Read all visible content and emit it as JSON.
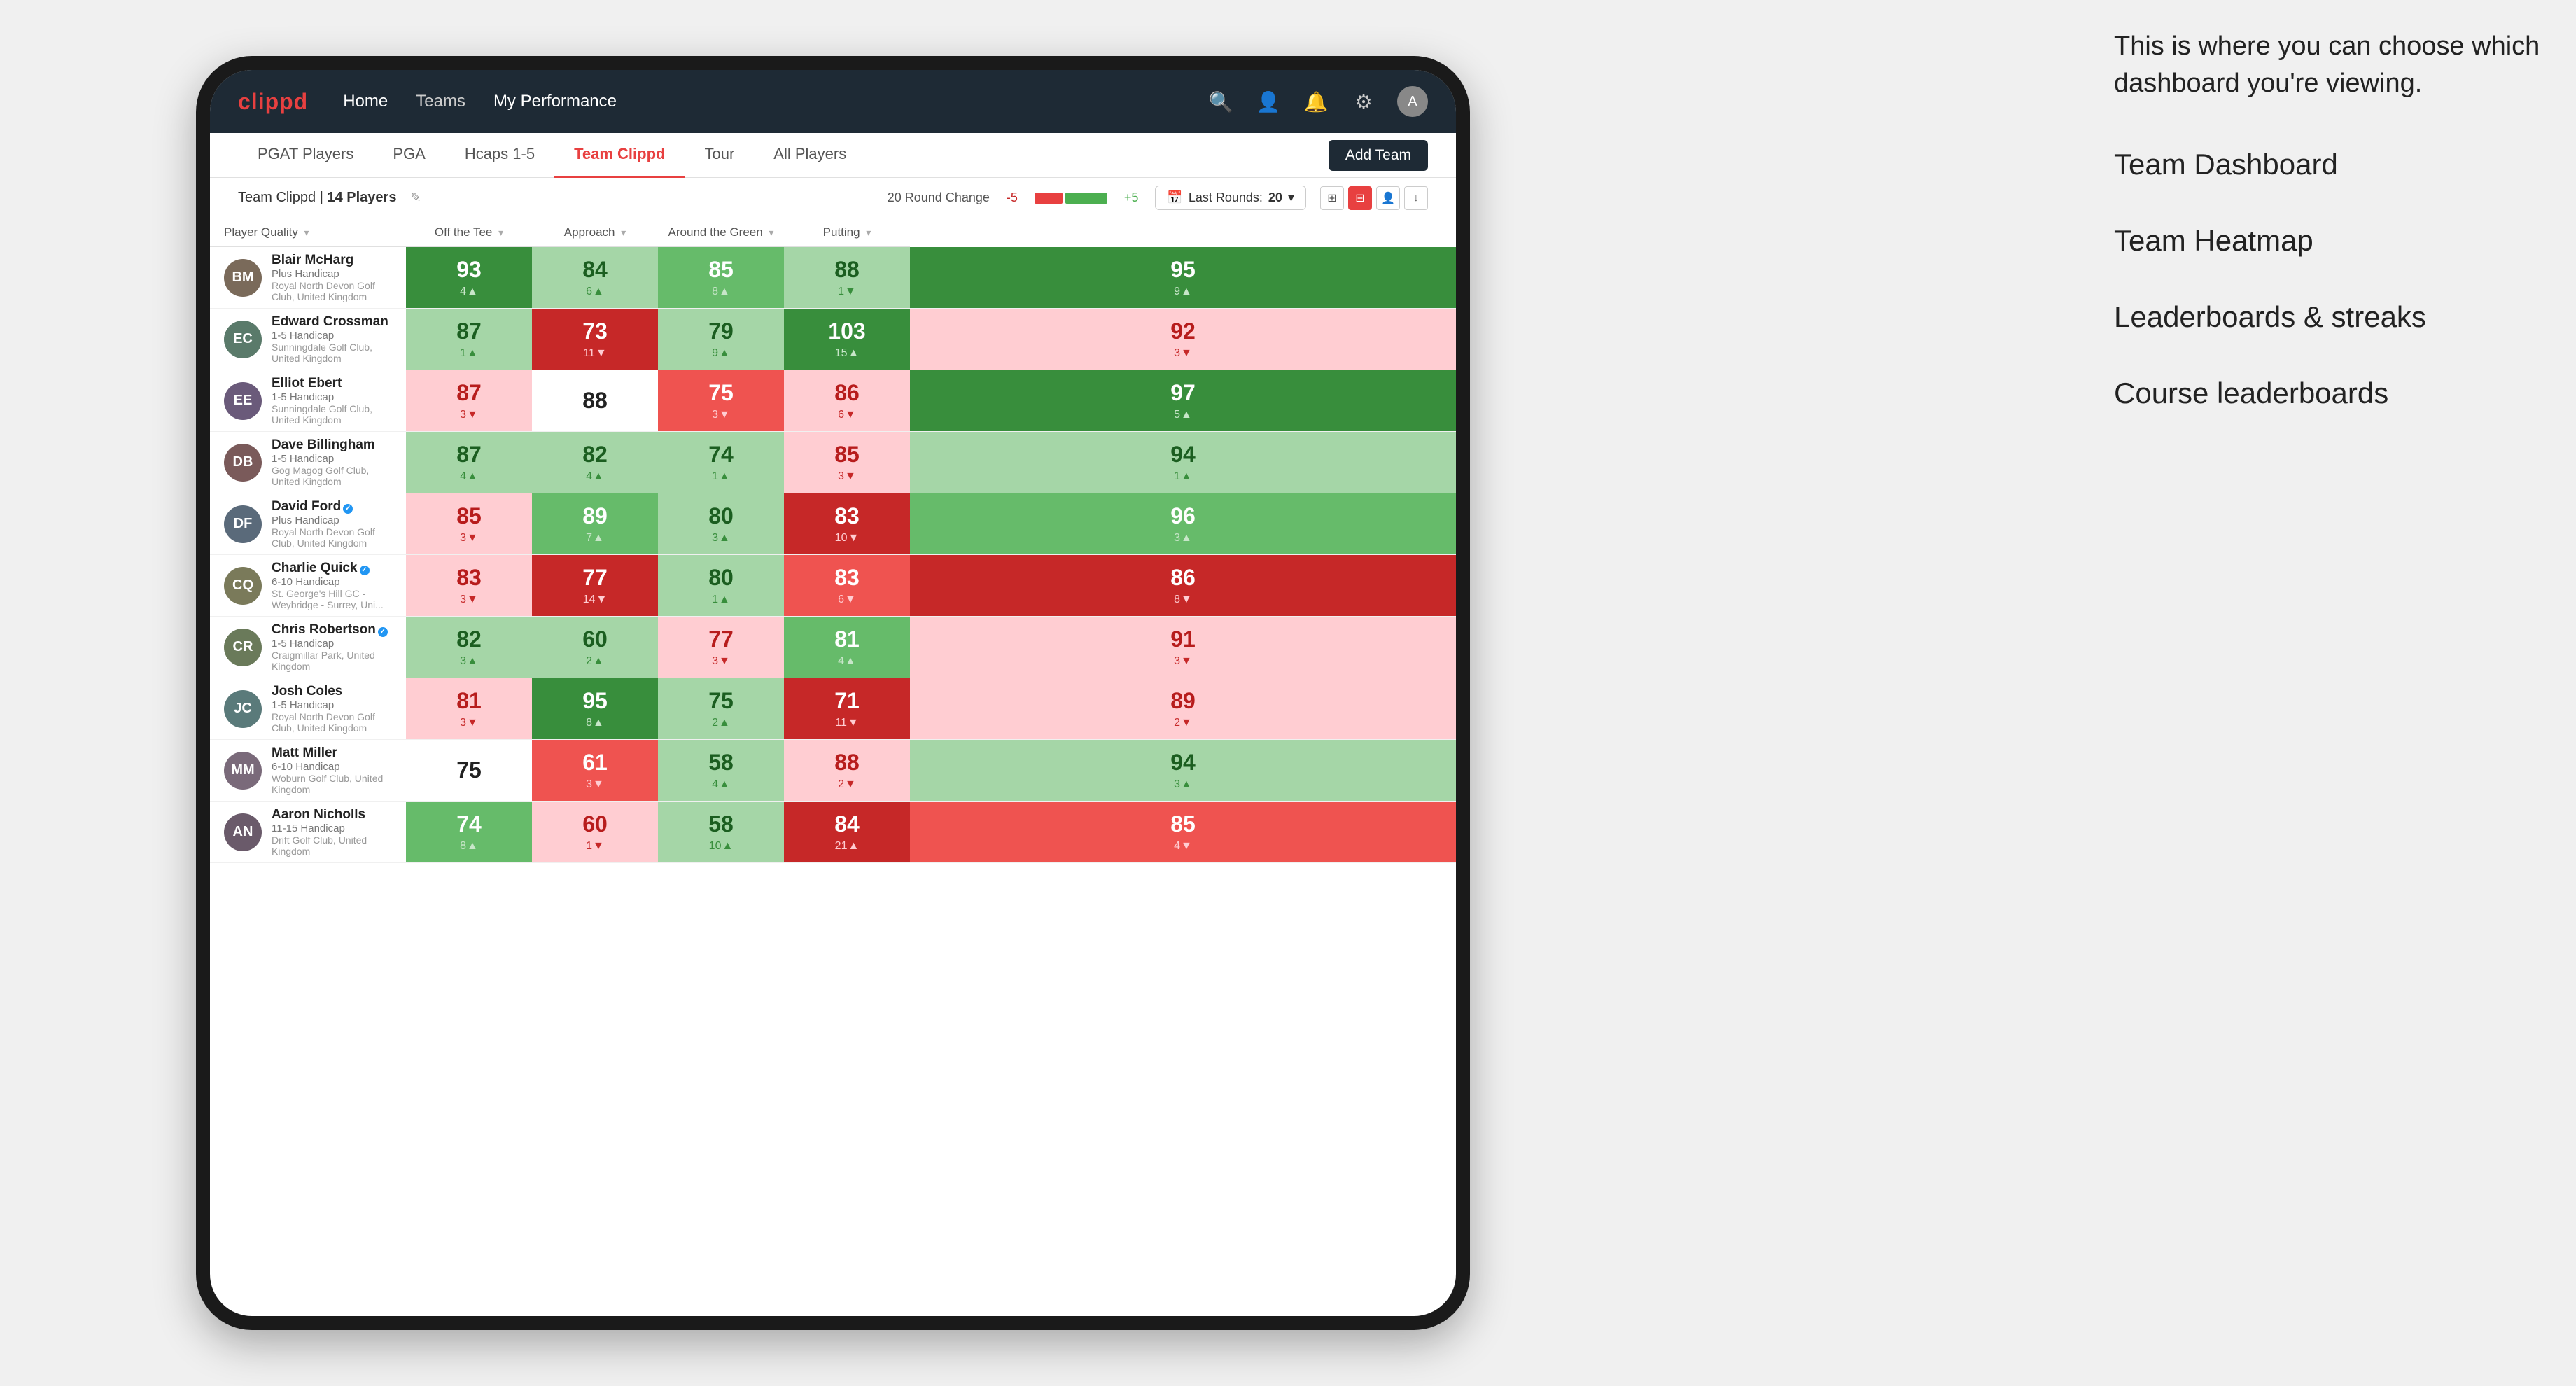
{
  "annotation": {
    "intro_text": "This is where you can choose which dashboard you're viewing.",
    "options": [
      "Team Dashboard",
      "Team Heatmap",
      "Leaderboards & streaks",
      "Course leaderboards"
    ]
  },
  "navbar": {
    "brand": "clippd",
    "links": [
      "Home",
      "Teams",
      "My Performance"
    ],
    "active_link": "My Performance"
  },
  "tabs": {
    "items": [
      "PGAT Players",
      "PGA",
      "Hcaps 1-5",
      "Team Clippd",
      "Tour",
      "All Players"
    ],
    "active": "Team Clippd",
    "add_button": "Add Team"
  },
  "toolbar": {
    "team_name": "Team Clippd",
    "player_count": "14 Players",
    "round_change_label": "20 Round Change",
    "range_neg": "-5",
    "range_pos": "+5",
    "last_rounds_label": "Last Rounds:",
    "last_rounds_count": "20"
  },
  "table": {
    "columns": {
      "player": "Player Quality",
      "off_tee": "Off the Tee",
      "approach": "Approach",
      "around_green": "Around the Green",
      "putting": "Putting"
    },
    "rows": [
      {
        "name": "Blair McHarg",
        "handicap": "Plus Handicap",
        "club": "Royal North Devon Golf Club, United Kingdom",
        "initials": "BM",
        "color": "#7a6a5a",
        "player_quality": {
          "score": 93,
          "change": 4,
          "dir": "up",
          "bg": "bg-green-dark"
        },
        "off_tee": {
          "score": 84,
          "change": 6,
          "dir": "up",
          "bg": "bg-green-light"
        },
        "approach": {
          "score": 85,
          "change": 8,
          "dir": "up",
          "bg": "bg-green-mid"
        },
        "around_green": {
          "score": 88,
          "change": 1,
          "dir": "down",
          "bg": "bg-green-light"
        },
        "putting": {
          "score": 95,
          "change": 9,
          "dir": "up",
          "bg": "bg-green-dark"
        }
      },
      {
        "name": "Edward Crossman",
        "handicap": "1-5 Handicap",
        "club": "Sunningdale Golf Club, United Kingdom",
        "initials": "EC",
        "color": "#5a7a6a",
        "player_quality": {
          "score": 87,
          "change": 1,
          "dir": "up",
          "bg": "bg-green-light"
        },
        "off_tee": {
          "score": 73,
          "change": 11,
          "dir": "down",
          "bg": "bg-red-dark"
        },
        "approach": {
          "score": 79,
          "change": 9,
          "dir": "up",
          "bg": "bg-green-light"
        },
        "around_green": {
          "score": 103,
          "change": 15,
          "dir": "up",
          "bg": "bg-green-dark"
        },
        "putting": {
          "score": 92,
          "change": 3,
          "dir": "down",
          "bg": "bg-red-light"
        }
      },
      {
        "name": "Elliot Ebert",
        "handicap": "1-5 Handicap",
        "club": "Sunningdale Golf Club, United Kingdom",
        "initials": "EE",
        "color": "#6a5a7a",
        "player_quality": {
          "score": 87,
          "change": 3,
          "dir": "down",
          "bg": "bg-red-light"
        },
        "off_tee": {
          "score": 88,
          "change": 0,
          "dir": "none",
          "bg": "bg-white"
        },
        "approach": {
          "score": 75,
          "change": 3,
          "dir": "down",
          "bg": "bg-red-mid"
        },
        "around_green": {
          "score": 86,
          "change": 6,
          "dir": "down",
          "bg": "bg-red-light"
        },
        "putting": {
          "score": 97,
          "change": 5,
          "dir": "up",
          "bg": "bg-green-dark"
        }
      },
      {
        "name": "Dave Billingham",
        "handicap": "1-5 Handicap",
        "club": "Gog Magog Golf Club, United Kingdom",
        "initials": "DB",
        "color": "#7a5a5a",
        "player_quality": {
          "score": 87,
          "change": 4,
          "dir": "up",
          "bg": "bg-green-light"
        },
        "off_tee": {
          "score": 82,
          "change": 4,
          "dir": "up",
          "bg": "bg-green-light"
        },
        "approach": {
          "score": 74,
          "change": 1,
          "dir": "up",
          "bg": "bg-green-light"
        },
        "around_green": {
          "score": 85,
          "change": 3,
          "dir": "down",
          "bg": "bg-red-light"
        },
        "putting": {
          "score": 94,
          "change": 1,
          "dir": "up",
          "bg": "bg-green-light"
        }
      },
      {
        "name": "David Ford",
        "handicap": "Plus Handicap",
        "club": "Royal North Devon Golf Club, United Kingdom",
        "initials": "DF",
        "color": "#5a6a7a",
        "verified": true,
        "player_quality": {
          "score": 85,
          "change": 3,
          "dir": "down",
          "bg": "bg-red-light"
        },
        "off_tee": {
          "score": 89,
          "change": 7,
          "dir": "up",
          "bg": "bg-green-mid"
        },
        "approach": {
          "score": 80,
          "change": 3,
          "dir": "up",
          "bg": "bg-green-light"
        },
        "around_green": {
          "score": 83,
          "change": 10,
          "dir": "down",
          "bg": "bg-red-dark"
        },
        "putting": {
          "score": 96,
          "change": 3,
          "dir": "up",
          "bg": "bg-green-mid"
        }
      },
      {
        "name": "Charlie Quick",
        "handicap": "6-10 Handicap",
        "club": "St. George's Hill GC - Weybridge - Surrey, Uni...",
        "initials": "CQ",
        "color": "#7a7a5a",
        "verified": true,
        "player_quality": {
          "score": 83,
          "change": 3,
          "dir": "down",
          "bg": "bg-red-light"
        },
        "off_tee": {
          "score": 77,
          "change": 14,
          "dir": "down",
          "bg": "bg-red-dark"
        },
        "approach": {
          "score": 80,
          "change": 1,
          "dir": "up",
          "bg": "bg-green-light"
        },
        "around_green": {
          "score": 83,
          "change": 6,
          "dir": "down",
          "bg": "bg-red-mid"
        },
        "putting": {
          "score": 86,
          "change": 8,
          "dir": "down",
          "bg": "bg-red-dark"
        }
      },
      {
        "name": "Chris Robertson",
        "handicap": "1-5 Handicap",
        "club": "Craigmillar Park, United Kingdom",
        "initials": "CR",
        "color": "#6a7a5a",
        "verified": true,
        "player_quality": {
          "score": 82,
          "change": 3,
          "dir": "up",
          "bg": "bg-green-light"
        },
        "off_tee": {
          "score": 60,
          "change": 2,
          "dir": "up",
          "bg": "bg-green-light"
        },
        "approach": {
          "score": 77,
          "change": 3,
          "dir": "down",
          "bg": "bg-red-light"
        },
        "around_green": {
          "score": 81,
          "change": 4,
          "dir": "up",
          "bg": "bg-green-mid"
        },
        "putting": {
          "score": 91,
          "change": 3,
          "dir": "down",
          "bg": "bg-red-light"
        }
      },
      {
        "name": "Josh Coles",
        "handicap": "1-5 Handicap",
        "club": "Royal North Devon Golf Club, United Kingdom",
        "initials": "JC",
        "color": "#5a7a7a",
        "player_quality": {
          "score": 81,
          "change": 3,
          "dir": "down",
          "bg": "bg-red-light"
        },
        "off_tee": {
          "score": 95,
          "change": 8,
          "dir": "up",
          "bg": "bg-green-dark"
        },
        "approach": {
          "score": 75,
          "change": 2,
          "dir": "up",
          "bg": "bg-green-light"
        },
        "around_green": {
          "score": 71,
          "change": 11,
          "dir": "down",
          "bg": "bg-red-dark"
        },
        "putting": {
          "score": 89,
          "change": 2,
          "dir": "down",
          "bg": "bg-red-light"
        }
      },
      {
        "name": "Matt Miller",
        "handicap": "6-10 Handicap",
        "club": "Woburn Golf Club, United Kingdom",
        "initials": "MM",
        "color": "#7a6a7a",
        "player_quality": {
          "score": 75,
          "change": 0,
          "dir": "none",
          "bg": "bg-white"
        },
        "off_tee": {
          "score": 61,
          "change": 3,
          "dir": "down",
          "bg": "bg-red-mid"
        },
        "approach": {
          "score": 58,
          "change": 4,
          "dir": "up",
          "bg": "bg-green-light"
        },
        "around_green": {
          "score": 88,
          "change": 2,
          "dir": "down",
          "bg": "bg-red-light"
        },
        "putting": {
          "score": 94,
          "change": 3,
          "dir": "up",
          "bg": "bg-green-light"
        }
      },
      {
        "name": "Aaron Nicholls",
        "handicap": "11-15 Handicap",
        "club": "Drift Golf Club, United Kingdom",
        "initials": "AN",
        "color": "#6a5a6a",
        "player_quality": {
          "score": 74,
          "change": 8,
          "dir": "up",
          "bg": "bg-green-mid"
        },
        "off_tee": {
          "score": 60,
          "change": 1,
          "dir": "down",
          "bg": "bg-red-light"
        },
        "approach": {
          "score": 58,
          "change": 10,
          "dir": "up",
          "bg": "bg-green-light"
        },
        "around_green": {
          "score": 84,
          "change": 21,
          "dir": "up",
          "bg": "bg-red-dark"
        },
        "putting": {
          "score": 85,
          "change": 4,
          "dir": "down",
          "bg": "bg-red-mid"
        }
      }
    ]
  }
}
